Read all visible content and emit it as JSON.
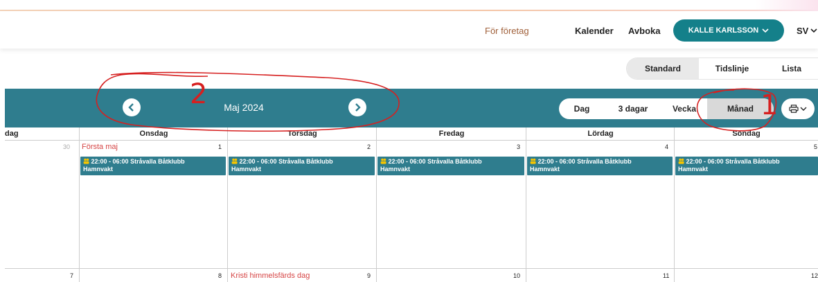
{
  "header": {
    "nav": {
      "company": "För företag",
      "calendar": "Kalender",
      "cancel": "Avboka"
    },
    "user_label": "KALLE KARLSSON",
    "language": "SV"
  },
  "view_toggle": {
    "standard": "Standard",
    "timeline": "Tidslinje",
    "list": "Lista",
    "selected": "Standard"
  },
  "toolbar": {
    "month_title": "Maj 2024",
    "ranges": {
      "day": "Dag",
      "three_days": "3 dagar",
      "week": "Vecka",
      "month": "Månad"
    },
    "selected_range": "Månad"
  },
  "calendar": {
    "weekdays": [
      "dag",
      "Onsdag",
      "Torsdag",
      "Fredag",
      "Lördag",
      "Söndag"
    ],
    "week1": {
      "days": [
        "30",
        "1",
        "2",
        "3",
        "4",
        "5"
      ],
      "holiday": "Första maj",
      "events": [
        {
          "time": "22:00 - 06:00",
          "title": "Stråvalla Båtklubb",
          "subtitle": "Hamnvakt"
        },
        {
          "time": "22:00 - 06:00",
          "title": "Stråvalla Båtklubb",
          "subtitle": "Hamnvakt"
        },
        {
          "time": "22:00 - 06:00",
          "title": "Stråvalla Båtklubb",
          "subtitle": "Hamnvakt"
        },
        {
          "time": "22:00 - 06:00",
          "title": "Stråvalla Båtklubb",
          "subtitle": "Hamnvakt"
        },
        {
          "time": "22:00 - 06:00",
          "title": "Stråvalla Båtklubb",
          "subtitle": "Hamnvakt"
        }
      ]
    },
    "week2": {
      "days": [
        "7",
        "8",
        "9",
        "10",
        "11",
        "12"
      ],
      "holiday": "Kristi himmelsfärds dag"
    }
  },
  "annotations": {
    "one": "1",
    "two": "2"
  },
  "colors": {
    "teal": "#2f7d8e",
    "user_button": "#14808a",
    "holiday": "#d64545",
    "annotation": "#d62020"
  }
}
